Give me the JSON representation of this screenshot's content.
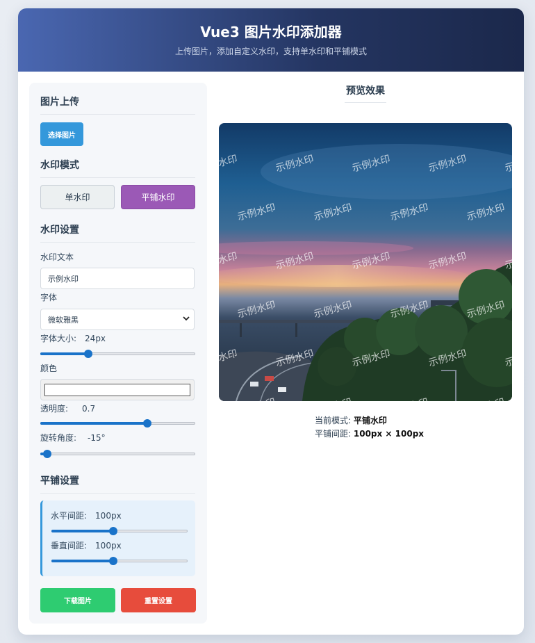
{
  "header": {
    "title": "Vue3 图片水印添加器",
    "subtitle": "上传图片，添加自定义水印，支持单水印和平铺模式"
  },
  "upload": {
    "section_title": "图片上传",
    "button_label": "选择图片"
  },
  "mode": {
    "section_title": "水印模式",
    "single_label": "单水印",
    "tile_label": "平铺水印",
    "active": "tile"
  },
  "settings": {
    "section_title": "水印设置",
    "text_label": "水印文本",
    "text_value": "示例水印",
    "font_label": "字体",
    "font_value": "微软雅黑",
    "font_size_label": "字体大小:",
    "font_size_value": "24px",
    "font_size_fraction": 0.3,
    "color_label": "颜色",
    "color_value": "#ffffff",
    "opacity_label": "透明度:",
    "opacity_value": "0.7",
    "opacity_fraction": 0.7,
    "rotation_label": "旋转角度:",
    "rotation_value": "-15°",
    "rotation_fraction": 0.02
  },
  "tile": {
    "section_title": "平铺设置",
    "h_gap_label": "水平间距:",
    "h_gap_value": "100px",
    "h_gap_fraction": 0.45,
    "v_gap_label": "垂直间距:",
    "v_gap_value": "100px",
    "v_gap_fraction": 0.45
  },
  "actions": {
    "download_label": "下载图片",
    "reset_label": "重置设置"
  },
  "preview": {
    "title": "预览效果",
    "watermark_text": "示例水印",
    "mode_label": "当前模式:",
    "mode_value": "平铺水印",
    "gap_label": "平铺间距:",
    "gap_value": "100px × 100px"
  },
  "colors": {
    "upload_button": "#3498db",
    "tile_button": "#9b59b6",
    "download_button": "#2ecc71",
    "reset_button": "#e74c3c",
    "slider_accent": "#1a73c9"
  }
}
